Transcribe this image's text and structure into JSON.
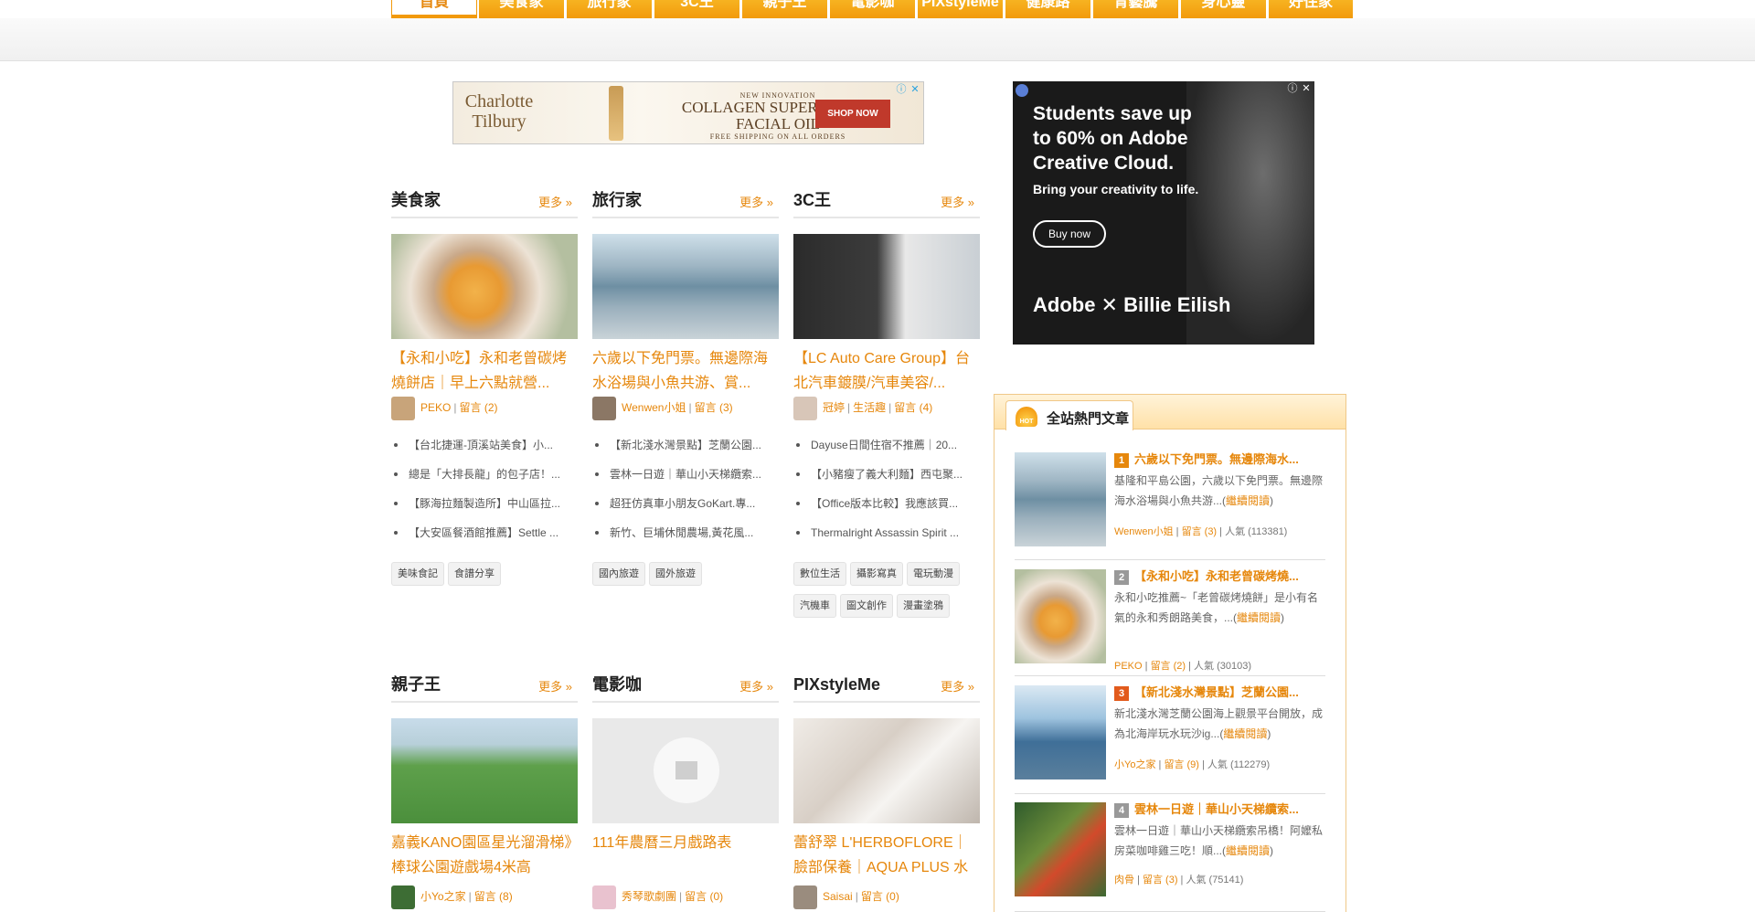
{
  "nav": {
    "tabs": [
      {
        "label": "首頁",
        "active": true
      },
      {
        "label": "美食家",
        "active": false
      },
      {
        "label": "旅行家",
        "active": false
      },
      {
        "label": "3C王",
        "active": false
      },
      {
        "label": "親子王",
        "active": false
      },
      {
        "label": "電影咖",
        "active": false
      },
      {
        "label": "PIXstyleMe",
        "active": false
      },
      {
        "label": "健康路",
        "active": false
      },
      {
        "label": "青藝騰",
        "active": false
      },
      {
        "label": "身心靈",
        "active": false
      },
      {
        "label": "好住家",
        "active": false
      }
    ]
  },
  "ads": {
    "top": {
      "brand": "Charlotte Tilbury",
      "tagline": "NEW INNOVATION",
      "product": "COLLAGEN SUPERFUSION FACIAL OIL",
      "shipping": "FREE SHIPPING ON ALL ORDERS",
      "cta": "SHOP NOW"
    },
    "side": {
      "headline": "Students save up to 60% on Adobe Creative Cloud.",
      "sub": "Bring your creativity to life.",
      "cta": "Buy now",
      "brand": "Adobe  ✕ Billie Eilish"
    }
  },
  "categories": [
    {
      "title": "美食家",
      "more": "更多 »",
      "post_title": "【永和小吃】永和老曾碳烤燒餅店｜早上六點就營...",
      "author": "PEKO",
      "comments": "留言 (2)",
      "links": [
        "【台北捷運-頂溪站美食】小...",
        "總是「大排長龍」的包子店！...",
        "【豚海拉麵製造所】中山區拉...",
        "【大安區餐酒館推薦】Settle ..."
      ],
      "tags": [
        "美味食記",
        "食譜分享"
      ]
    },
    {
      "title": "旅行家",
      "more": "更多 »",
      "post_title": "六歲以下免門票。無邊際海水浴場與小魚共游、賞...",
      "author": "Wenwen小姐",
      "comments": "留言 (3)",
      "links": [
        "【新北淺水灣景點】芝蘭公園...",
        "雲林一日遊｜華山小天梯纜索...",
        "超狂仿真車小朋友GoKart.專...",
        "新竹、巨埔休閒農場,黃花風..."
      ],
      "tags": [
        "國內旅遊",
        "國外旅遊"
      ]
    },
    {
      "title": "3C王",
      "more": "更多 »",
      "post_title": "【LC Auto Care Group】台北汽車鍍膜/汽車美容/...",
      "author": "冠婷",
      "extra": "生活趣",
      "comments": "留言 (4)",
      "links": [
        "Dayuse日間住宿不推薦｜20...",
        "【小豬瘦了義大利麵】西屯聚...",
        "【Office版本比較】我應該買...",
        "Thermalright Assassin Spirit ..."
      ],
      "tags": [
        "數位生活",
        "攝影寫真",
        "電玩動漫",
        "汽機車",
        "圖文創作",
        "漫畫塗鴉"
      ]
    },
    {
      "title": "親子王",
      "more": "更多 »",
      "post_title": "嘉義KANO園區星光溜滑梯》棒球公園遊戲場4米高",
      "author": "小Yo之家",
      "comments": "留言 (8)"
    },
    {
      "title": "電影咖",
      "more": "更多 »",
      "post_title": "111年農曆三月戲路表",
      "author": "秀琴歌劇團",
      "comments": "留言 (0)"
    },
    {
      "title": "PIXstyleMe",
      "more": "更多 »",
      "post_title": "蕾舒翠 L'HERBOFLORE｜臉部保養｜AQUA PLUS 水",
      "author": "Saisai",
      "comments": "留言 (0)"
    }
  ],
  "hot": {
    "badge": "HOT",
    "title": "全站熱門文章",
    "items": [
      {
        "rank": "1",
        "title": "六歲以下免門票。無邊際海水...",
        "desc": "基隆和平島公園，六歲以下免門票。無邊際海水浴場與小魚共游...",
        "read": "繼續閱讀",
        "author": "Wenwen小姐",
        "comments": "留言 (3)",
        "views": "人氣 (113381)"
      },
      {
        "rank": "2",
        "title": "【永和小吃】永和老曾碳烤燒...",
        "desc": "永和小吃推薦~「老曾碳烤燒餅」是小有名氣的永和秀朗路美食，...",
        "read": "繼續閱讀",
        "author": "PEKO",
        "comments": "留言 (2)",
        "views": "人氣 (30103)"
      },
      {
        "rank": "3",
        "title": "【新北淺水灣景點】芝蘭公園...",
        "desc": "新北淺水灣芝蘭公園海上觀景平台開放，成為北海岸玩水玩沙ig...",
        "read": "繼續閱讀",
        "author": "小Yo之家",
        "comments": "留言 (9)",
        "views": "人氣 (112279)"
      },
      {
        "rank": "4",
        "title": "雲林一日遊｜華山小天梯纜索...",
        "desc": "雲林一日遊｜華山小天梯纜索吊橋！阿嬤私房菜咖啡雞三吃！順...",
        "read": "繼續閱讀",
        "author": "肉骨",
        "comments": "留言 (3)",
        "views": "人氣 (75141)"
      }
    ]
  }
}
